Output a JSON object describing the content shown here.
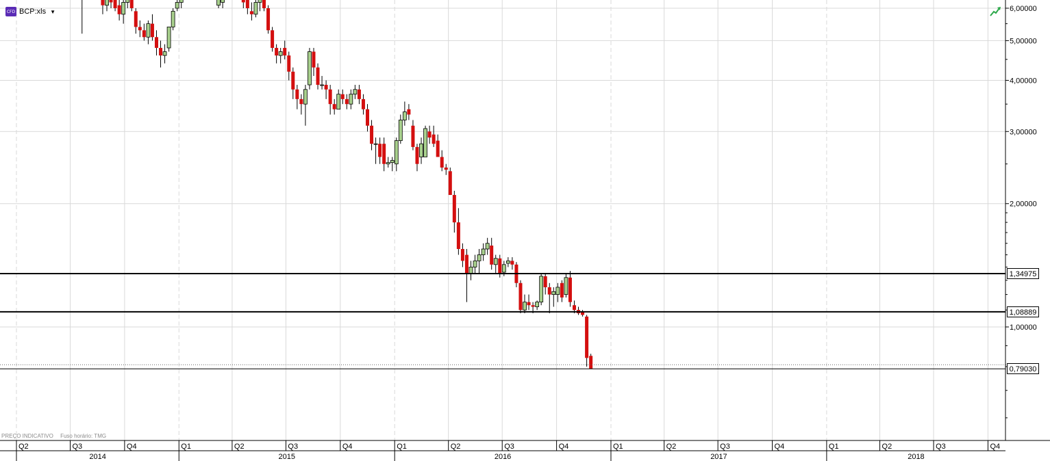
{
  "instrument": {
    "badge": "CFD",
    "symbol": "BCP:xls"
  },
  "footer": {
    "indicative": "PREÇO INDICATIVO",
    "timezone": "Fuso horário: TMG"
  },
  "colors": {
    "up": "#a8d08d",
    "down": "#d40f0f",
    "grid": "#d9d9d9",
    "line": "#000000",
    "icon": "#2da84a"
  },
  "price_tags": {
    "upper": "1,34975",
    "lower": "1,08889",
    "current": "0,79030"
  },
  "chart_data": {
    "type": "candlestick",
    "y_scale": "log",
    "ylim": [
      0.56,
      6.5
    ],
    "y_ticks": [
      {
        "value": 6.0,
        "label": "6,00000"
      },
      {
        "value": 5.0,
        "label": "5,00000"
      },
      {
        "value": 4.0,
        "label": "4,00000"
      },
      {
        "value": 3.0,
        "label": "3,00000"
      },
      {
        "value": 2.0,
        "label": "2,00000"
      },
      {
        "value": 1.0,
        "label": "1,00000"
      }
    ],
    "horizontal_lines": [
      1.34975,
      1.08889,
      0.7903
    ],
    "quarter_labels": [
      {
        "label": "Q2",
        "start": "2014-04",
        "end": "2014-07"
      },
      {
        "label": "Q3",
        "start": "2014-07",
        "end": "2014-10"
      },
      {
        "label": "Q4",
        "start": "2014-10",
        "end": "2015-01"
      },
      {
        "label": "Q1",
        "start": "2015-01",
        "end": "2015-04"
      },
      {
        "label": "Q2",
        "start": "2015-04",
        "end": "2015-07"
      },
      {
        "label": "Q3",
        "start": "2015-07",
        "end": "2015-10"
      },
      {
        "label": "Q4",
        "start": "2015-10",
        "end": "2016-01"
      },
      {
        "label": "Q1",
        "start": "2016-01",
        "end": "2016-04"
      },
      {
        "label": "Q2",
        "start": "2016-04",
        "end": "2016-07"
      },
      {
        "label": "Q3",
        "start": "2016-07",
        "end": "2016-10"
      },
      {
        "label": "Q4",
        "start": "2016-10",
        "end": "2017-01"
      },
      {
        "label": "Q1",
        "start": "2017-01",
        "end": "2017-04"
      },
      {
        "label": "Q2",
        "start": "2017-04",
        "end": "2017-07"
      },
      {
        "label": "Q3",
        "start": "2017-07",
        "end": "2017-10"
      },
      {
        "label": "Q4",
        "start": "2017-10",
        "end": "2018-01"
      },
      {
        "label": "Q1",
        "start": "2018-01",
        "end": "2018-04"
      },
      {
        "label": "Q2",
        "start": "2018-04",
        "end": "2018-07"
      },
      {
        "label": "Q3",
        "start": "2018-07",
        "end": "2018-10"
      },
      {
        "label": "Q4",
        "start": "2018-10",
        "end": "2019-01"
      }
    ],
    "year_labels": [
      {
        "label": "2014",
        "start": "2014-04",
        "end": "2015-01"
      },
      {
        "label": "2015",
        "start": "2015-01",
        "end": "2016-01"
      },
      {
        "label": "2016",
        "start": "2016-01",
        "end": "2017-01"
      },
      {
        "label": "2017",
        "start": "2017-01",
        "end": "2018-01"
      },
      {
        "label": "2018",
        "start": "2018-01",
        "end": "2019-01"
      }
    ],
    "ohlc": [
      [
        "2014-07-21",
        7.2,
        7.3,
        5.2,
        6.3
      ],
      [
        "2014-08-25",
        6.6,
        6.9,
        5.8,
        6.1
      ],
      [
        "2014-09-01",
        6.1,
        6.6,
        5.9,
        6.4
      ],
      [
        "2014-09-08",
        6.4,
        6.7,
        6.0,
        6.2
      ],
      [
        "2014-09-15",
        6.4,
        6.6,
        5.9,
        6.0
      ],
      [
        "2014-09-22",
        6.1,
        6.5,
        5.6,
        5.8
      ],
      [
        "2014-09-29",
        5.8,
        6.4,
        5.5,
        6.2
      ],
      [
        "2014-10-06",
        6.2,
        6.7,
        6.0,
        6.5
      ],
      [
        "2014-10-13",
        6.5,
        6.9,
        5.9,
        6.0
      ],
      [
        "2014-10-20",
        5.9,
        6.0,
        5.2,
        5.4
      ],
      [
        "2014-10-27",
        5.4,
        5.6,
        5.1,
        5.3
      ],
      [
        "2014-11-03",
        5.3,
        5.5,
        5.0,
        5.1
      ],
      [
        "2014-11-10",
        5.1,
        5.6,
        4.9,
        5.5
      ],
      [
        "2014-11-17",
        5.5,
        5.8,
        5.0,
        5.1
      ],
      [
        "2014-11-24",
        5.1,
        5.3,
        4.6,
        4.8
      ],
      [
        "2014-12-01",
        4.8,
        5.0,
        4.3,
        4.6
      ],
      [
        "2014-12-08",
        4.6,
        4.9,
        4.4,
        4.7
      ],
      [
        "2014-12-15",
        4.8,
        5.3,
        4.7,
        5.4
      ],
      [
        "2014-12-22",
        5.4,
        6.0,
        5.3,
        5.9
      ],
      [
        "2014-12-29",
        6.0,
        6.3,
        5.9,
        6.2
      ],
      [
        "2015-01-05",
        6.2,
        6.4,
        6.0,
        6.3
      ],
      [
        "2015-03-09",
        6.1,
        6.6,
        6.0,
        6.5
      ],
      [
        "2015-03-16",
        6.2,
        6.8,
        6.0,
        6.6
      ],
      [
        "2015-04-20",
        6.6,
        7.0,
        6.0,
        6.2
      ],
      [
        "2015-04-27",
        6.4,
        6.7,
        5.8,
        6.0
      ],
      [
        "2015-05-04",
        5.9,
        6.2,
        5.6,
        5.8
      ],
      [
        "2015-05-11",
        5.8,
        6.3,
        5.7,
        6.2
      ],
      [
        "2015-05-18",
        6.2,
        6.5,
        5.9,
        6.4
      ],
      [
        "2015-05-25",
        6.3,
        6.6,
        5.9,
        6.0
      ],
      [
        "2015-06-01",
        6.0,
        6.1,
        5.2,
        5.3
      ],
      [
        "2015-06-08",
        5.3,
        5.4,
        4.7,
        4.8
      ],
      [
        "2015-06-15",
        4.8,
        4.9,
        4.4,
        4.6
      ],
      [
        "2015-06-22",
        4.6,
        4.8,
        4.4,
        4.7
      ],
      [
        "2015-06-29",
        4.8,
        5.0,
        4.5,
        4.6
      ],
      [
        "2015-07-06",
        4.6,
        4.7,
        4.0,
        4.2
      ],
      [
        "2015-07-13",
        4.2,
        4.3,
        3.6,
        3.8
      ],
      [
        "2015-07-20",
        3.8,
        3.9,
        3.4,
        3.6
      ],
      [
        "2015-07-27",
        3.6,
        3.7,
        3.3,
        3.5
      ],
      [
        "2015-08-03",
        3.5,
        3.9,
        3.1,
        3.8
      ],
      [
        "2015-08-10",
        3.9,
        4.8,
        3.8,
        4.7
      ],
      [
        "2015-08-17",
        4.7,
        4.8,
        4.1,
        4.3
      ],
      [
        "2015-08-24",
        4.3,
        4.4,
        3.8,
        3.9
      ],
      [
        "2015-08-31",
        3.9,
        4.1,
        3.8,
        3.9
      ],
      [
        "2015-09-07",
        3.9,
        4.0,
        3.6,
        3.8
      ],
      [
        "2015-09-14",
        3.8,
        3.9,
        3.3,
        3.5
      ],
      [
        "2015-09-21",
        3.5,
        3.6,
        3.3,
        3.4
      ],
      [
        "2015-09-28",
        3.4,
        3.8,
        3.4,
        3.7
      ],
      [
        "2015-10-05",
        3.7,
        3.8,
        3.5,
        3.6
      ],
      [
        "2015-10-12",
        3.6,
        3.7,
        3.4,
        3.5
      ],
      [
        "2015-10-19",
        3.5,
        3.8,
        3.4,
        3.7
      ],
      [
        "2015-10-26",
        3.7,
        3.9,
        3.6,
        3.8
      ],
      [
        "2015-11-02",
        3.8,
        3.9,
        3.5,
        3.6
      ],
      [
        "2015-11-09",
        3.6,
        3.7,
        3.3,
        3.4
      ],
      [
        "2015-11-16",
        3.4,
        3.5,
        3.0,
        3.1
      ],
      [
        "2015-11-23",
        3.1,
        3.2,
        2.7,
        2.8
      ],
      [
        "2015-11-30",
        2.8,
        2.9,
        2.5,
        2.8
      ],
      [
        "2015-12-07",
        2.8,
        2.9,
        2.5,
        2.6
      ],
      [
        "2015-12-14",
        2.8,
        2.9,
        2.4,
        2.5
      ],
      [
        "2015-12-21",
        2.5,
        2.6,
        2.45,
        2.52
      ],
      [
        "2015-12-28",
        2.52,
        2.6,
        2.4,
        2.55
      ],
      [
        "2016-01-04",
        2.5,
        2.9,
        2.4,
        2.85
      ],
      [
        "2016-01-11",
        2.85,
        3.3,
        2.8,
        3.2
      ],
      [
        "2016-01-18",
        3.2,
        3.55,
        3.1,
        3.35
      ],
      [
        "2016-01-25",
        3.4,
        3.5,
        3.2,
        3.3
      ],
      [
        "2016-02-01",
        3.1,
        3.2,
        2.7,
        2.75
      ],
      [
        "2016-02-08",
        2.75,
        2.8,
        2.4,
        2.5
      ],
      [
        "2016-02-15",
        2.6,
        2.9,
        2.5,
        2.8
      ],
      [
        "2016-02-22",
        2.6,
        3.1,
        2.6,
        3.05
      ],
      [
        "2016-02-29",
        3.0,
        3.1,
        2.8,
        2.9
      ],
      [
        "2016-03-07",
        2.95,
        3.1,
        2.75,
        2.8
      ],
      [
        "2016-03-14",
        2.85,
        2.95,
        2.6,
        2.6
      ],
      [
        "2016-03-21",
        2.6,
        2.7,
        2.4,
        2.45
      ],
      [
        "2016-03-28",
        2.45,
        2.5,
        2.35,
        2.42
      ],
      [
        "2016-04-04",
        2.4,
        2.45,
        2.1,
        2.1
      ],
      [
        "2016-04-11",
        2.1,
        2.15,
        1.7,
        1.8
      ],
      [
        "2016-04-18",
        1.8,
        1.95,
        1.5,
        1.55
      ],
      [
        "2016-04-25",
        1.55,
        1.6,
        1.4,
        1.45
      ],
      [
        "2016-05-02",
        1.5,
        1.55,
        1.15,
        1.35
      ],
      [
        "2016-05-09",
        1.35,
        1.45,
        1.3,
        1.4
      ],
      [
        "2016-05-16",
        1.4,
        1.5,
        1.35,
        1.45
      ],
      [
        "2016-05-23",
        1.45,
        1.55,
        1.35,
        1.5
      ],
      [
        "2016-05-30",
        1.5,
        1.6,
        1.45,
        1.55
      ],
      [
        "2016-06-06",
        1.55,
        1.65,
        1.5,
        1.6
      ],
      [
        "2016-06-13",
        1.58,
        1.65,
        1.38,
        1.42
      ],
      [
        "2016-06-20",
        1.42,
        1.5,
        1.35,
        1.47
      ],
      [
        "2016-06-27",
        1.47,
        1.5,
        1.32,
        1.35
      ],
      [
        "2016-07-04",
        1.36,
        1.45,
        1.33,
        1.42
      ],
      [
        "2016-07-11",
        1.43,
        1.48,
        1.4,
        1.45
      ],
      [
        "2016-07-18",
        1.45,
        1.48,
        1.38,
        1.42
      ],
      [
        "2016-07-25",
        1.42,
        1.44,
        1.25,
        1.28
      ],
      [
        "2016-08-01",
        1.28,
        1.3,
        1.08,
        1.1
      ],
      [
        "2016-08-08",
        1.1,
        1.2,
        1.08,
        1.15
      ],
      [
        "2016-08-15",
        1.15,
        1.2,
        1.1,
        1.13
      ],
      [
        "2016-08-22",
        1.13,
        1.15,
        1.08,
        1.12
      ],
      [
        "2016-08-29",
        1.12,
        1.16,
        1.1,
        1.15
      ],
      [
        "2016-09-05",
        1.15,
        1.35,
        1.13,
        1.33
      ],
      [
        "2016-09-12",
        1.33,
        1.35,
        1.2,
        1.25
      ],
      [
        "2016-09-19",
        1.25,
        1.28,
        1.08,
        1.2
      ],
      [
        "2016-09-26",
        1.2,
        1.25,
        1.12,
        1.22
      ],
      [
        "2016-10-03",
        1.2,
        1.28,
        1.15,
        1.25
      ],
      [
        "2016-10-10",
        1.28,
        1.3,
        1.15,
        1.18
      ],
      [
        "2016-10-17",
        1.2,
        1.35,
        1.18,
        1.32
      ],
      [
        "2016-10-24",
        1.32,
        1.37,
        1.12,
        1.15
      ],
      [
        "2016-10-31",
        1.13,
        1.16,
        1.08,
        1.1
      ],
      [
        "2016-11-07",
        1.1,
        1.12,
        1.07,
        1.08
      ],
      [
        "2016-11-14",
        1.09,
        1.1,
        1.06,
        1.07
      ],
      [
        "2016-11-21",
        1.06,
        1.07,
        0.8,
        0.84
      ],
      [
        "2016-11-28",
        0.85,
        0.86,
        0.79,
        0.79
      ]
    ]
  }
}
